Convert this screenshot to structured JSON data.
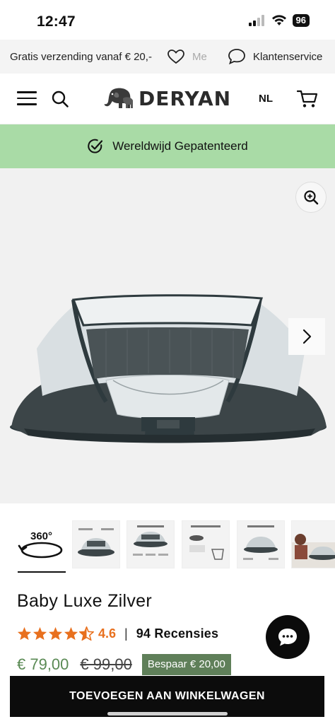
{
  "status": {
    "time": "12:47",
    "battery": "96"
  },
  "promo": {
    "shipping": "Gratis verzending vanaf € 20,-",
    "wishlist": "Me",
    "service": "Klantenservice"
  },
  "header": {
    "brand": "DERYAN",
    "language": "NL"
  },
  "patent": {
    "text": "Wereldwijd Gepatenteerd"
  },
  "gallery": {
    "thumb_360_label": "360°"
  },
  "product": {
    "title": "Baby Luxe Zilver",
    "rating": "4.6",
    "rating_fraction": 0.92,
    "reviews": "94 Recensies",
    "price_new": "€ 79,00",
    "price_old": "€ 99,00",
    "save_label": "Bespaar € 20,00",
    "accent_color": "#e8701e",
    "price_color": "#5a8a54"
  },
  "actions": {
    "add_to_cart": "TOEVOEGEN AAN WINKELWAGEN"
  },
  "colors": {
    "patent_bar": "#a9dba6",
    "save_badge": "#5f7f59"
  }
}
